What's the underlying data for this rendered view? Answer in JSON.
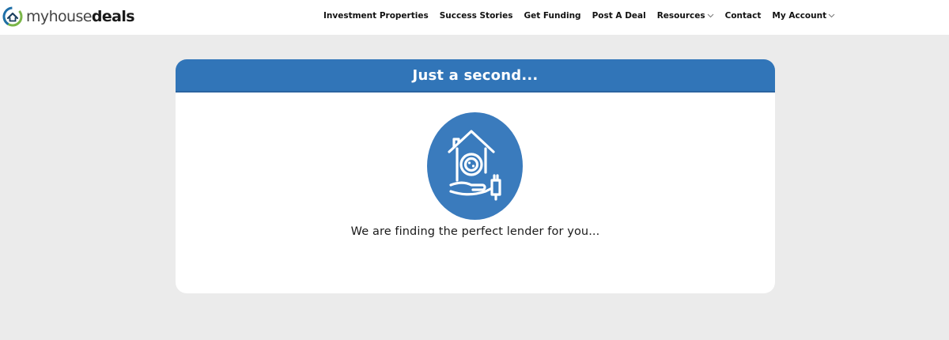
{
  "brand": {
    "name_prefix": "my",
    "name_thin": "house",
    "name_bold": "deals",
    "colors": {
      "ring_green": "#7ab648",
      "ring_blue": "#1f6fa8",
      "ring_dark": "#1b3f5e"
    },
    "icon": "logo-ring-icon"
  },
  "nav": {
    "items": [
      {
        "label": "Investment Properties"
      },
      {
        "label": "Success Stories"
      },
      {
        "label": "Get Funding"
      },
      {
        "label": "Post A Deal"
      },
      {
        "label": "Resources",
        "dropdown": true,
        "icon": "chevron-down-icon"
      },
      {
        "label": "Contact"
      },
      {
        "label": "My Account",
        "dropdown": true,
        "icon": "chevron-down-icon"
      }
    ]
  },
  "card": {
    "title": "Just a second...",
    "message": "We are finding the perfect lender for you...",
    "icon": "house-in-hand-plug-icon",
    "colors": {
      "header": "#3175b8",
      "badge": "#3a7bbd",
      "page_bg": "#ebebeb"
    }
  }
}
